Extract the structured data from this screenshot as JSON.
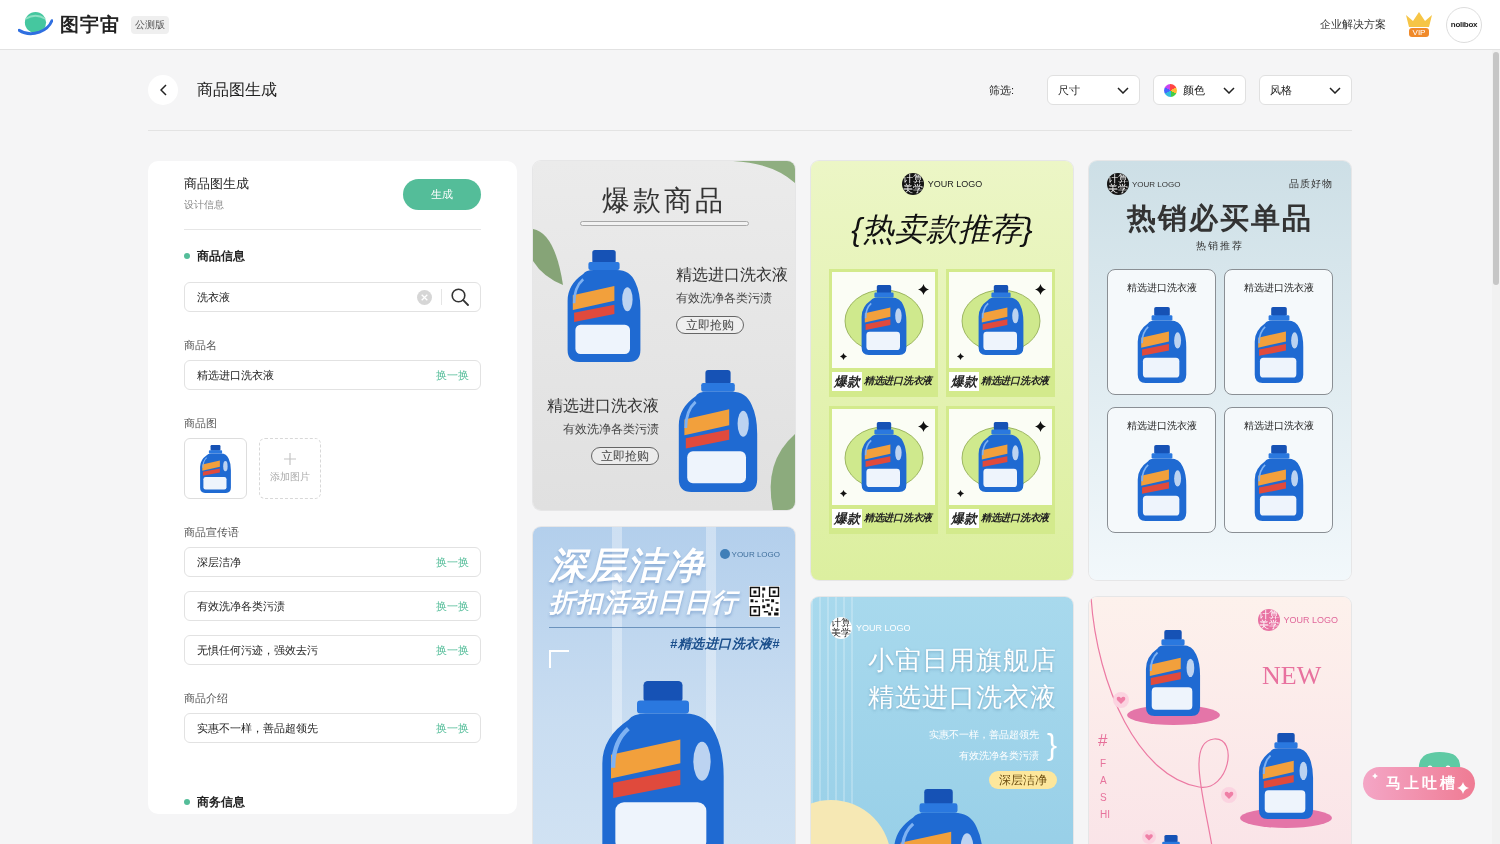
{
  "topbar": {
    "brand": "图宇宙",
    "badge": "公测版",
    "link": "企业解决方案",
    "vip": "VIP",
    "avatar": "nolibox"
  },
  "header": {
    "title": "商品图生成",
    "filter_label": "筛选:",
    "filters": [
      {
        "kind": "plain",
        "label": "尺寸"
      },
      {
        "kind": "color",
        "label": "颜色"
      },
      {
        "kind": "plain",
        "label": "风格"
      }
    ]
  },
  "panel": {
    "title": "商品图生成",
    "subtitle": "设计信息",
    "generate_button": "生成",
    "product_section": "商品信息",
    "search": {
      "value": "洗衣液"
    },
    "name_field": {
      "label": "商品名",
      "value": "精选进口洗衣液",
      "action": "换一换"
    },
    "image_field": {
      "label": "商品图",
      "add_label": "添加图片"
    },
    "slogans": {
      "label": "商品宣传语",
      "items": [
        {
          "value": "深层洁净",
          "action": "换一换"
        },
        {
          "value": "有效洗净各类污渍",
          "action": "换一换"
        },
        {
          "value": "无惧任何污迹，强效去污",
          "action": "换一换"
        }
      ]
    },
    "intro": {
      "label": "商品介绍",
      "items": [
        {
          "value": "实惠不一样，善品超领先",
          "action": "换一换"
        }
      ]
    },
    "business_section": "商务信息"
  },
  "posters": [
    {
      "kind": "showcase",
      "title": "爆款商品",
      "items": [
        {
          "name": "精选进口洗衣液",
          "slogan": "有效洗净各类污渍",
          "button": "立即抢购"
        },
        {
          "name": "精选进口洗衣液",
          "slogan": "有效洗净各类污渍",
          "button": "立即抢购"
        }
      ]
    },
    {
      "kind": "tiles",
      "logo_mark": "计算美学",
      "logo": "YOUR LOGO",
      "title": "{热卖款推荐}",
      "tiles": [
        {
          "tag": "爆款",
          "name": "精选进口洗衣液"
        },
        {
          "tag": "爆款",
          "name": "精选进口洗衣液"
        },
        {
          "tag": "爆款",
          "name": "精选进口洗衣液"
        },
        {
          "tag": "爆款",
          "name": "精选进口洗衣液"
        }
      ]
    },
    {
      "kind": "cards",
      "logo_mark": "计算美学",
      "logo": "YOUR LOGO",
      "corner": "品质好物",
      "title": "热销必买单品",
      "subtitle": "热销推荐",
      "cards": [
        {
          "name": "精选进口洗衣液"
        },
        {
          "name": "精选进口洗衣液"
        },
        {
          "name": "精选进口洗衣液"
        },
        {
          "name": "精选进口洗衣液"
        }
      ]
    },
    {
      "kind": "promo",
      "logo": "YOUR LOGO",
      "title": "深层洁净",
      "subtitle": "折扣活动日日行",
      "hashtag": "#精选进口洗衣液#"
    },
    {
      "kind": "store",
      "logo_mark": "计算美学",
      "logo": "YOUR LOGO",
      "title_lines": [
        "小宙日用旗舰店",
        "精选进口洗衣液"
      ],
      "lines": [
        "实惠不一样，善品超领先",
        "有效洗净各类污渍"
      ],
      "brace": "}",
      "tag": "深层洁净"
    },
    {
      "kind": "fashion",
      "logo_mark": "计算美学",
      "logo": "YOUR LOGO",
      "badge": "NEW",
      "hash": "#",
      "vertical": "FASHI"
    }
  ],
  "feedback_button": "马上吐槽"
}
